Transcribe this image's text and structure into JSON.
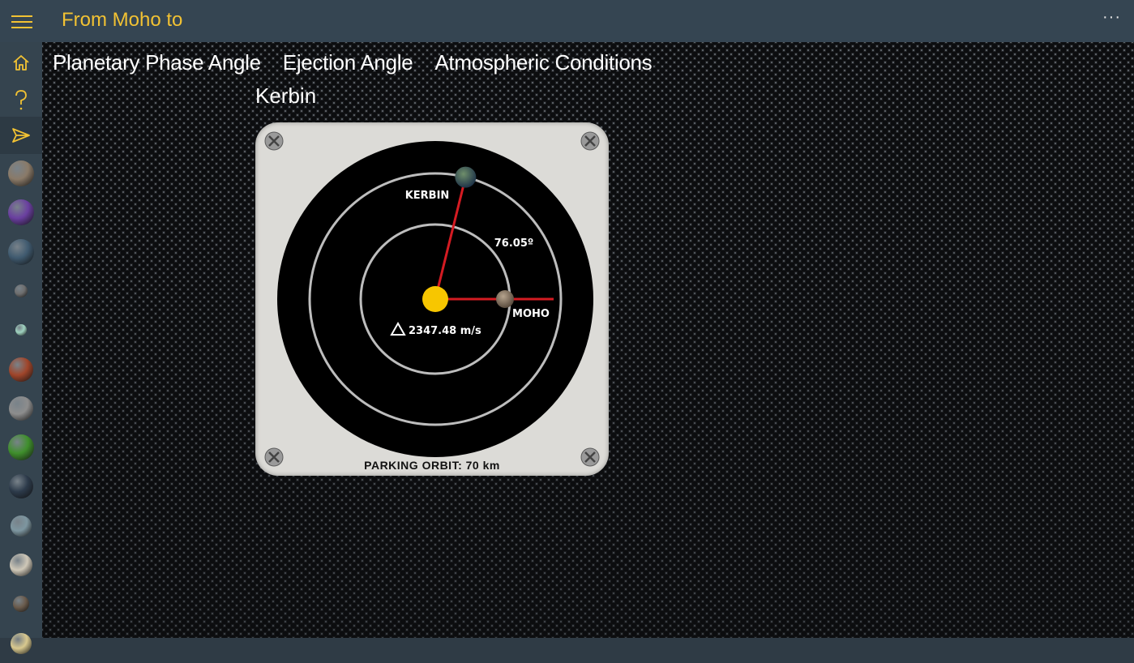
{
  "app": {
    "title": "From Moho to"
  },
  "header": {
    "more_label": "···"
  },
  "sidebar": {
    "nav": [
      {
        "name": "home",
        "icon": "home-icon"
      },
      {
        "name": "help",
        "icon": "question-icon"
      },
      {
        "name": "send",
        "icon": "send-icon"
      }
    ],
    "planets": [
      {
        "name": "moho",
        "color": "#8a7a68"
      },
      {
        "name": "eve",
        "color": "#6a3fa0"
      },
      {
        "name": "kerbin",
        "color": "#3f5a6f"
      },
      {
        "name": "mun",
        "color": "#6e6e6e"
      },
      {
        "name": "minmus",
        "color": "#9fd3c0"
      },
      {
        "name": "duna",
        "color": "#a0452a"
      },
      {
        "name": "ike",
        "color": "#8d8d8d"
      },
      {
        "name": "jool",
        "color": "#3f8f2c"
      },
      {
        "name": "laythe",
        "color": "#2c3a4a"
      },
      {
        "name": "vall",
        "color": "#7d96a0"
      },
      {
        "name": "tylo",
        "color": "#cfc8b8"
      },
      {
        "name": "bop",
        "color": "#6a5b4c"
      },
      {
        "name": "pol",
        "color": "#d9c98f"
      }
    ]
  },
  "tabs": [
    "Planetary Phase Angle",
    "Ejection Angle",
    "Atmospheric Conditions"
  ],
  "destination": "Kerbin",
  "diagram": {
    "origin_label": "KERBIN",
    "target_label": "MOHO",
    "angle_label": "76.05º",
    "delta_v_label": "2347.48 m/s",
    "parking_orbit_label": "PARKING ORBIT: 70 km",
    "phase_angle_deg": 76.05,
    "line_color": "#d41b22",
    "sun_color": "#f7c600"
  }
}
